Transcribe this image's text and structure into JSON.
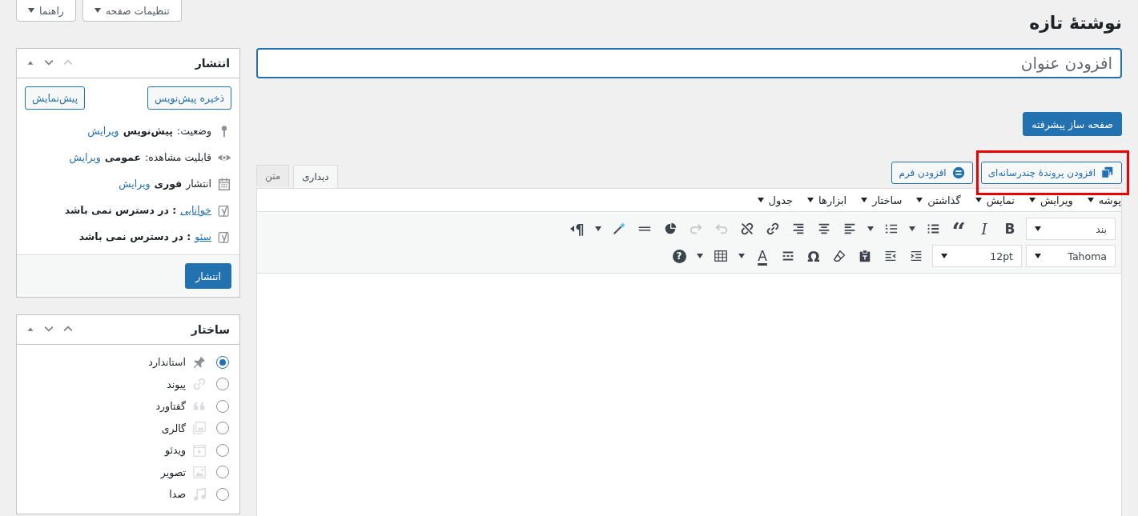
{
  "screen_options": [
    {
      "label": "تنظیمات صفحه"
    },
    {
      "label": "راهنما"
    }
  ],
  "page_title": "نوشتهٔ تازه",
  "title_field": {
    "placeholder": "افزودن عنوان"
  },
  "builder_button": "صفحه ساز پیشرفته",
  "media_buttons": [
    {
      "label": "افزودن پروندهٔ چندرسانه‌ای",
      "kind": "media",
      "highlighted": true
    },
    {
      "label": "افزودن فرم",
      "kind": "form",
      "highlighted": false
    }
  ],
  "editor": {
    "tabs": [
      {
        "label": "دیداری",
        "selected": true
      },
      {
        "label": "متن",
        "selected": false
      }
    ],
    "menu": [
      "پوشه",
      "ویرایش",
      "نمایش",
      "گذاشتن",
      "ساختار",
      "ابزارها",
      "جدول"
    ],
    "toolbar_rows": [
      [
        {
          "kind": "select",
          "value": "بند"
        },
        {
          "kind": "bold",
          "label": "B",
          "disabled": false
        },
        {
          "kind": "italic",
          "label": "I",
          "disabled": false
        },
        {
          "kind": "quote",
          "label": "“",
          "disabled": false
        },
        {
          "kind": "bullist",
          "disabled": false
        },
        {
          "kind": "caret"
        },
        {
          "kind": "numlist",
          "disabled": false
        },
        {
          "kind": "caret"
        },
        {
          "kind": "alignleft",
          "disabled": false
        },
        {
          "kind": "aligncenter",
          "disabled": false
        },
        {
          "kind": "alignright",
          "disabled": false
        },
        {
          "kind": "link",
          "disabled": false
        },
        {
          "kind": "unlink",
          "disabled": false
        },
        {
          "kind": "undo",
          "disabled": true
        },
        {
          "kind": "redo",
          "disabled": true
        },
        {
          "kind": "pie",
          "disabled": false
        },
        {
          "kind": "hr",
          "disabled": false
        },
        {
          "kind": "wand",
          "disabled": false
        },
        {
          "kind": "caret"
        },
        {
          "kind": "rtl",
          "label": "¶",
          "disabled": false
        }
      ],
      [
        {
          "kind": "select",
          "value": "Tahoma"
        },
        {
          "kind": "select",
          "value": "12pt"
        },
        {
          "kind": "indent",
          "disabled": false
        },
        {
          "kind": "outdent",
          "disabled": false
        },
        {
          "kind": "paste",
          "disabled": false
        },
        {
          "kind": "eraser",
          "disabled": false
        },
        {
          "kind": "omega",
          "label": "Ω",
          "disabled": false
        },
        {
          "kind": "pagebreak",
          "disabled": false
        },
        {
          "kind": "textcolor",
          "label": "A",
          "disabled": false
        },
        {
          "kind": "caret"
        },
        {
          "kind": "table",
          "disabled": false
        },
        {
          "kind": "caret"
        },
        {
          "kind": "help",
          "label": "?",
          "disabled": false
        }
      ]
    ]
  },
  "publish": {
    "title": "انتشار",
    "save_draft": "ذخیره پیش‌نویس",
    "preview": "پیش‌نمایش",
    "rows": [
      {
        "kind": "status",
        "label": "وضعیت:",
        "value": "پیش‌نویس",
        "link": "ویرایش"
      },
      {
        "kind": "visibility",
        "label": "قابلیت مشاهده:",
        "value": "عمومی",
        "link": "ویرایش"
      },
      {
        "kind": "schedule",
        "label": "انتشار",
        "value": "فوری",
        "link": "ویرایش"
      },
      {
        "kind": "readability",
        "link": "خوانایی",
        "value": ": در دسترس نمی باشد"
      },
      {
        "kind": "seo",
        "link": "سئو",
        "value": ": در دسترس نمی باشد"
      }
    ],
    "publish_button": "انتشار"
  },
  "format": {
    "title": "ساختار",
    "items": [
      {
        "kind": "standard",
        "label": "استاندارد",
        "selected": true
      },
      {
        "kind": "link",
        "label": "پیوند",
        "selected": false
      },
      {
        "kind": "quote",
        "label": "گفتاورد",
        "selected": false
      },
      {
        "kind": "gallery",
        "label": "گالری",
        "selected": false
      },
      {
        "kind": "video",
        "label": "ویدئو",
        "selected": false
      },
      {
        "kind": "image",
        "label": "تصویر",
        "selected": false
      },
      {
        "kind": "audio",
        "label": "صدا",
        "selected": false
      }
    ]
  }
}
